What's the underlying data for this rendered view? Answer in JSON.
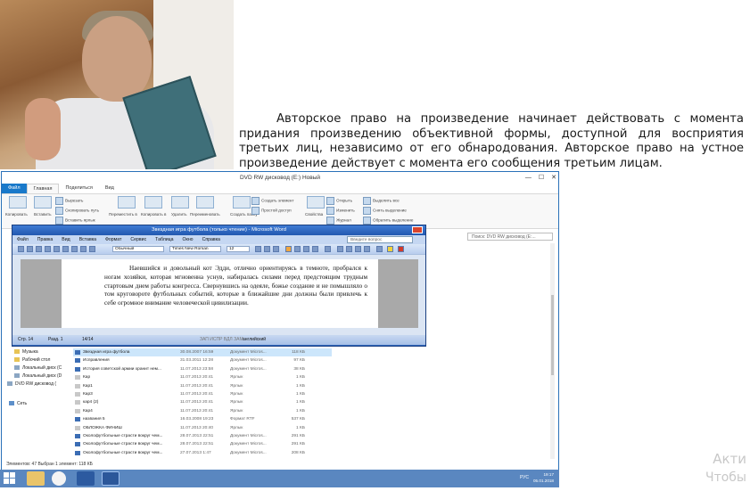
{
  "quote": "Авторское право на произведение начинает действовать с момента придания произведению объективной формы, доступной для восприятия третьих лиц, независимо от его обнародования. Авторское право на устное произведение действует с момента его сообщения третьим лицам.",
  "explorer": {
    "title": "DVD RW дисковод (E:) Новый",
    "tabs": [
      "Файл",
      "Главная",
      "Поделиться",
      "Вид"
    ],
    "ribbon": {
      "copy": "Копировать",
      "paste": "Вставить",
      "cut": "Вырезать",
      "copy_path": "Скопировать путь",
      "paste_shortcut": "Вставить ярлык",
      "move_to": "Переместить в",
      "copy_to": "Копировать в",
      "delete": "Удалить",
      "rename": "Переименовать",
      "new_folder": "Создать папку",
      "new_item": "Создать элемент",
      "easy_access": "Простой доступ",
      "properties": "Свойства",
      "open": "Открыть",
      "edit": "Изменить",
      "history": "Журнал",
      "select_all": "Выделить все",
      "select_none": "Снять выделение",
      "invert": "Обратить выделение"
    },
    "search_placeholder": "Поиск: DVD RW дисковод (E:...",
    "nav": [
      "Музыка",
      "Рабочий стол",
      "Локальный диск (C",
      "Локальный диск (D",
      "DVD RW дисковод (",
      "Сеть"
    ],
    "files": [
      {
        "name": "Звездная игра футбола",
        "date": "30.08.2007 16:59",
        "type": "Документ Micros...",
        "size": "118 КБ",
        "selected": true
      },
      {
        "name": "Исправления",
        "date": "31.03.2011 12:28",
        "type": "Документ Micros...",
        "size": "97 КБ"
      },
      {
        "name": "История советской армии хранит нем...",
        "date": "11.07.2013 23:58",
        "type": "Документ Micros...",
        "size": "38 КБ"
      },
      {
        "name": "Кар",
        "date": "11.07.2013 20:41",
        "type": "Ярлык",
        "size": "1 КБ"
      },
      {
        "name": "Кар1",
        "date": "11.07.2013 20:41",
        "type": "Ярлык",
        "size": "1 КБ"
      },
      {
        "name": "Кар3",
        "date": "11.07.2013 20:41",
        "type": "Ярлык",
        "size": "1 КБ"
      },
      {
        "name": "кар4 (2)",
        "date": "11.07.2013 20:41",
        "type": "Ярлык",
        "size": "1 КБ"
      },
      {
        "name": "Кар4",
        "date": "11.07.2013 20:41",
        "type": "Ярлык",
        "size": "1 КБ"
      },
      {
        "name": "названия 5",
        "date": "16.03.2008 19:23",
        "type": "Формат RTF",
        "size": "537 КБ"
      },
      {
        "name": "ОБЛОЖКА ФИНИШ",
        "date": "11.07.2013 20:40",
        "type": "Ярлык",
        "size": "1 КБ"
      },
      {
        "name": "Околофутбольные страсти вокруг чем...",
        "date": "28.07.2013 22:51",
        "type": "Документ Micros...",
        "size": "291 КБ"
      },
      {
        "name": "Околофутбольные страсти вокруг чем...",
        "date": "28.07.2013 22:51",
        "type": "Документ Micros...",
        "size": "291 КБ"
      },
      {
        "name": "Околофутбольные страсти вокруг чем...",
        "date": "27.07.2013 1:47",
        "type": "Документ Micros...",
        "size": "208 КБ"
      }
    ],
    "status": "Элементов: 47     Выбран 1 элемент: 118 КБ"
  },
  "word": {
    "title": "Звездная игра футбола (только чтение) - Microsoft Word",
    "menu": [
      "Файл",
      "Правка",
      "Вид",
      "Вставка",
      "Формат",
      "Сервис",
      "Таблица",
      "Окно",
      "Справка"
    ],
    "help_placeholder": "Введите вопрос",
    "style": "Обычный",
    "font": "Times New Roman",
    "size": "12",
    "body": "Наевшийся и довольный кот Эдди, отлично ориентируясь в темноте, пробрался к ногам хозяйки, которая мгновенна уснув, набиралась силами перед предстоящим трудным стартовым днем работы конгресса. Свернувшись на одеяле, божье создание и не помышляло о том круговороте футбольных событий, которые в ближайшие дни должны были привлечь к себе огромное внимание человеческой цивилизации.",
    "status": {
      "page": "Стр. 14",
      "section": "Разд. 1",
      "pages": "14/14",
      "modes": "ЗАП  ИСПР  ВДЛ  ЗАМ",
      "lang": "английский"
    }
  },
  "taskbar": {
    "lang": "РУС",
    "time": "19:17",
    "date": "05.01.2018"
  },
  "watermark": [
    "Акти",
    "Чтобы"
  ],
  "colors": {
    "accent": "#1979ca",
    "word_blue": "#2e64b8",
    "taskbar": "#5a87c0"
  }
}
